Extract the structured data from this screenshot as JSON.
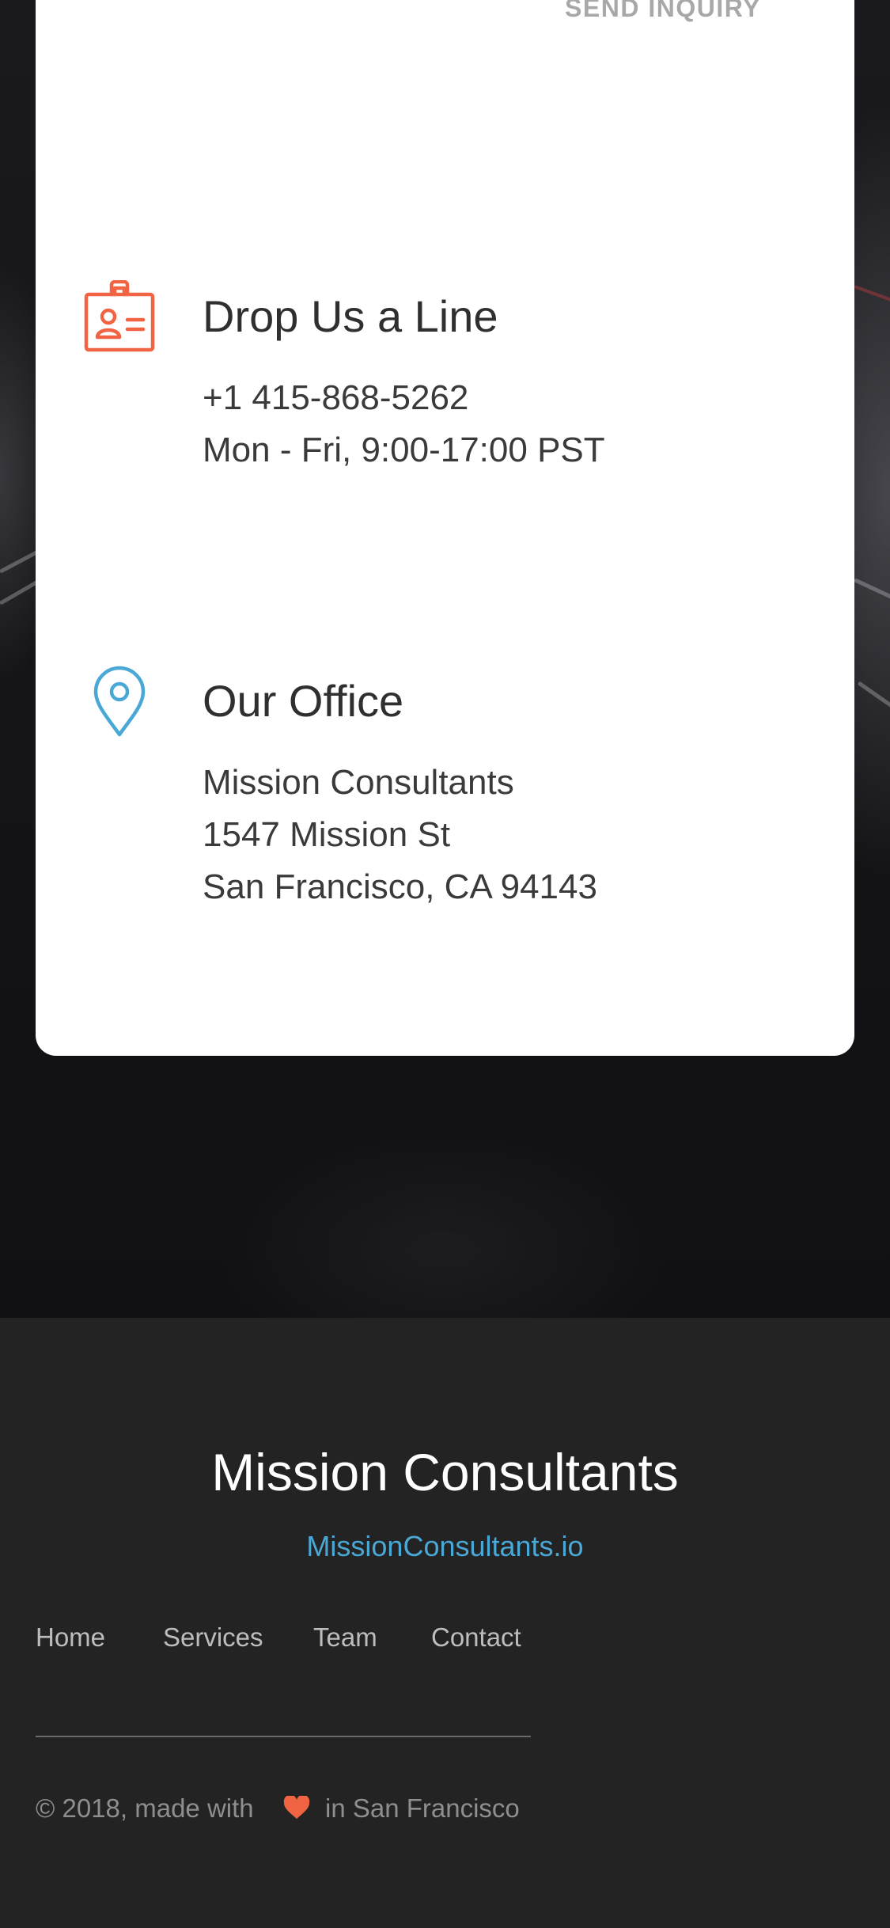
{
  "card": {
    "send_inquiry": "SEND INQUIRY",
    "contact": {
      "icon": "id-badge-icon",
      "title": "Drop Us a Line",
      "phone": "+1 415-868-5262",
      "hours": "Mon - Fri, 9:00-17:00 PST"
    },
    "office": {
      "icon": "map-pin-icon",
      "title": "Our Office",
      "lines": [
        "Mission Consultants",
        "1547 Mission St",
        "San Francisco, CA 94143"
      ]
    }
  },
  "footer": {
    "brand": "Mission Consultants",
    "site": "MissionConsultants.io",
    "nav": [
      "Home",
      "Services",
      "Team",
      "Contact"
    ],
    "copyright_prefix": "© 2018, made with",
    "copyright_icon": "heart-icon",
    "copyright_suffix": "in San Francisco"
  },
  "colors": {
    "accent_orange": "#f06443",
    "accent_blue": "#4aa8d6",
    "footer_bg": "#232323"
  }
}
